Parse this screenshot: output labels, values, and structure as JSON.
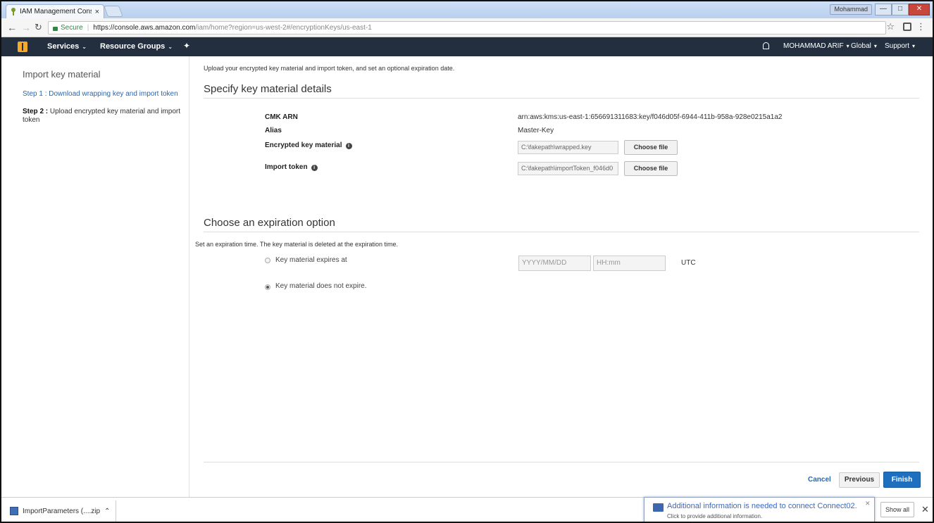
{
  "browser": {
    "tab_title": "IAM Management Conso",
    "tab_close": "×",
    "window_user": "Mohammad",
    "secure_label": "Secure",
    "url_host": "https://console.aws.amazon.com",
    "url_path": "/iam/home?region=us-west-2#/encryptionKeys/us-east-1",
    "icons": [
      "back-icon",
      "forward-icon",
      "reload-icon",
      "star-icon",
      "extension-icon",
      "menu-icon"
    ]
  },
  "navbar": {
    "services": "Services",
    "resource_groups": "Resource Groups",
    "user": "MOHAMMAD ARIF",
    "region": "Global",
    "support": "Support"
  },
  "sidebar": {
    "title": "Import key material",
    "step1": "Step 1 : Download wrapping key and import token",
    "step2_prefix": "Step 2 :",
    "step2_text": " Upload encrypted key material and import token"
  },
  "main": {
    "intro": "Upload your encrypted key material and import token, and set an optional expiration date.",
    "section1_title": "Specify key material details",
    "fields": {
      "cmk_arn_label": "CMK ARN",
      "cmk_arn_value": "arn:aws:kms:us-east-1:656691311683:key/f046d05f-6944-411b-958a-928e0215a1a2",
      "alias_label": "Alias",
      "alias_value": "Master-Key",
      "encrypted_label": "Encrypted key material",
      "encrypted_value": "C:\\fakepath\\wrapped.key",
      "token_label": "Import token",
      "token_value": "C:\\fakepath\\importToken_f046d0",
      "choose_file": "Choose file"
    },
    "section2_title": "Choose an expiration option",
    "expiration_desc": "Set an expiration time. The key material is deleted at the expiration time.",
    "option_expires": "Key material expires at",
    "option_never": "Key material does not expire.",
    "date_placeholder": "YYYY/MM/DD",
    "time_placeholder": "HH:mm",
    "timezone": "UTC",
    "selected_option": "never",
    "buttons": {
      "cancel": "Cancel",
      "previous": "Previous",
      "finish": "Finish"
    }
  },
  "colors": {
    "nav_bg": "#232f3e",
    "link": "#2767b1",
    "primary": "#1f6fc0",
    "aws_orange": "#f7a928"
  },
  "downloads": {
    "file": "ImportParameters (....zip",
    "notification_title": "Additional information is needed to connect Connect02.",
    "notification_sub": "Click to provide additional information.",
    "show_all": "Show all"
  }
}
